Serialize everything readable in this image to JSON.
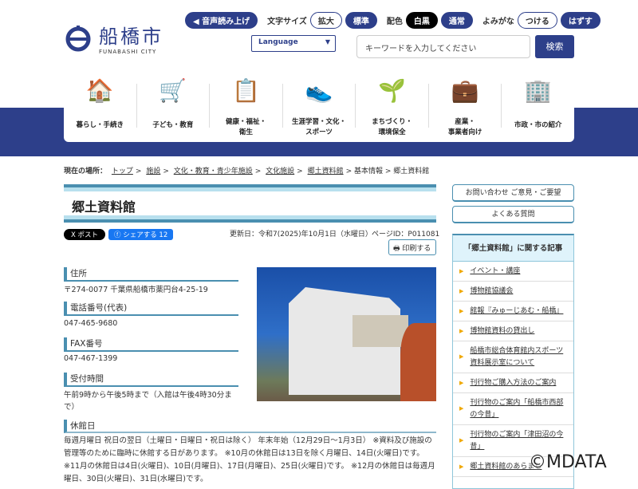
{
  "header": {
    "logo_jp": "船橋市",
    "logo_en": "FUNABASHI CITY",
    "read_aloud": "音声読み上げ",
    "text_size_label": "文字サイズ",
    "text_size_large": "拡大",
    "text_size_normal": "標準",
    "color_label": "配色",
    "color_bw": "白黒",
    "color_normal": "通常",
    "furigana_label": "よみがな",
    "furigana_on": "つける",
    "furigana_off": "はずす",
    "language": "Language",
    "search_placeholder": "キーワードを入力してください",
    "search_button": "検索"
  },
  "nav": [
    {
      "label": "暮らし・手続き",
      "icon": "🏠"
    },
    {
      "label": "子ども・教育",
      "icon": "🛒"
    },
    {
      "label": "健康・福祉・\n衛生",
      "icon": "📋"
    },
    {
      "label": "生涯学習・文化・\nスポーツ",
      "icon": "👟"
    },
    {
      "label": "まちづくり・\n環境保全",
      "icon": "🌱"
    },
    {
      "label": "産業・\n事業者向け",
      "icon": "💼"
    },
    {
      "label": "市政・市の紹介",
      "icon": "🏢"
    }
  ],
  "breadcrumb": {
    "label": "現在の場所：",
    "items": [
      "トップ",
      "施設",
      "文化・教育・青少年施設",
      "文化施設",
      "郷土資料館",
      "基本情報",
      "郷土資料館"
    ]
  },
  "page": {
    "title": "郷土資料館",
    "x_post": "X ポスト",
    "fb_share": "シェアする 12",
    "updated": "更新日：令和7(2025)年10月1日（水曜日）",
    "page_id": "ページID：P011081",
    "print": "印刷する"
  },
  "info": {
    "address_h": "住所",
    "address": "〒274-0077 千葉県船橋市薬円台4-25-19",
    "tel_h": "電話番号(代表)",
    "tel": "047-465-9680",
    "fax_h": "FAX番号",
    "fax": "047-467-1399",
    "hours_h": "受付時間",
    "hours": "午前9時から午後5時まで（入館は午後4時30分まで）",
    "closed_h": "休館日",
    "closed": "毎週月曜日 祝日の翌日（土曜日・日曜日・祝日は除く） 年末年始（12月29日～1月3日） ※資料及び施設の管理等のために臨時に休館する日があります。 ※10月の休館日は13日を除く月曜日、14日(火曜日)です。 ※11月の休館日は4日(火曜日)、10日(月曜日)、17日(月曜日)、25日(火曜日)です。 ※12月の休館日は毎週月曜日、30日(火曜日)、31日(水曜日)です。"
  },
  "sidebar": {
    "contact": "お問い合わせ ご意見・ご要望",
    "faq": "よくある質問",
    "related_title": "「郷土資料館」に関する記事",
    "related": [
      "イベント・講座",
      "博物館協議会",
      "館報『みゅーじあむ・船橋』",
      "博物館資料の貸出し",
      "船橋市総合体育館内スポーツ資料展示室について",
      "刊行物ご購入方法のご案内",
      "刊行物のご案内「船橋市西部の今昔」",
      "刊行物のご案内「津田沼の今昔」",
      "郷土資料館のあらまし"
    ]
  },
  "watermark": "©MDATA"
}
